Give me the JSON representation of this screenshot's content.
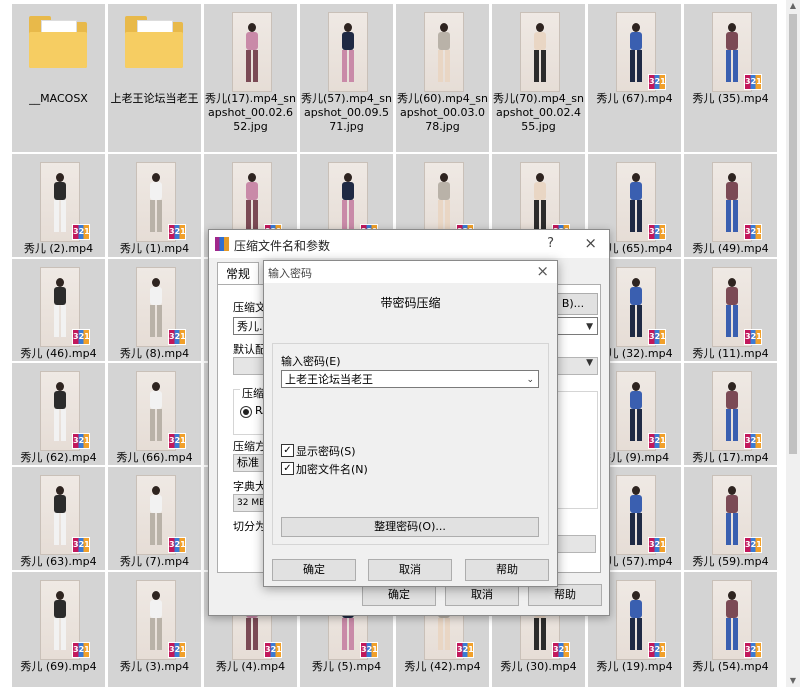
{
  "explorer": {
    "rows": [
      [
        {
          "type": "folder",
          "name": "__MACOSX"
        },
        {
          "type": "folder",
          "name": "上老王论坛当老王"
        },
        {
          "type": "image",
          "name": "秀儿(17).mp4_snapshot_00.02.652.jpg"
        },
        {
          "type": "image",
          "name": "秀儿(57).mp4_snapshot_00.09.571.jpg"
        },
        {
          "type": "image",
          "name": "秀儿(60).mp4_snapshot_00.03.078.jpg"
        },
        {
          "type": "image",
          "name": "秀儿(70).mp4_snapshot_00.02.455.jpg"
        },
        {
          "type": "video",
          "name": "秀儿 (67).mp4"
        },
        {
          "type": "video",
          "name": "秀儿 (35).mp4"
        }
      ],
      [
        {
          "type": "video",
          "name": "秀儿 (2).mp4"
        },
        {
          "type": "video",
          "name": "秀儿 (1).mp4"
        },
        {
          "type": "video",
          "name": ""
        },
        {
          "type": "video",
          "name": ""
        },
        {
          "type": "video",
          "name": ""
        },
        {
          "type": "video",
          "name": ""
        },
        {
          "type": "video",
          "name": "秀儿 (65).mp4"
        },
        {
          "type": "video",
          "name": "秀儿 (49).mp4"
        }
      ],
      [
        {
          "type": "video",
          "name": "秀儿 (46).mp4"
        },
        {
          "type": "video",
          "name": "秀儿 (8).mp4"
        },
        {
          "type": "video",
          "name": ""
        },
        {
          "type": "video",
          "name": ""
        },
        {
          "type": "video",
          "name": ""
        },
        {
          "type": "video",
          "name": ""
        },
        {
          "type": "video",
          "name": "秀儿 (32).mp4"
        },
        {
          "type": "video",
          "name": "秀儿 (11).mp4"
        }
      ],
      [
        {
          "type": "video",
          "name": "秀儿 (62).mp4"
        },
        {
          "type": "video",
          "name": "秀儿 (66).mp4"
        },
        {
          "type": "video",
          "name": ""
        },
        {
          "type": "video",
          "name": ""
        },
        {
          "type": "video",
          "name": ""
        },
        {
          "type": "video",
          "name": ""
        },
        {
          "type": "video",
          "name": "秀儿 (9).mp4"
        },
        {
          "type": "video",
          "name": "秀儿 (17).mp4"
        }
      ],
      [
        {
          "type": "video",
          "name": "秀儿 (63).mp4"
        },
        {
          "type": "video",
          "name": "秀儿 (7).mp4"
        },
        {
          "type": "video",
          "name": ""
        },
        {
          "type": "video",
          "name": ""
        },
        {
          "type": "video",
          "name": ""
        },
        {
          "type": "video",
          "name": ""
        },
        {
          "type": "video",
          "name": "秀儿 (57).mp4"
        },
        {
          "type": "video",
          "name": "秀儿 (59).mp4"
        }
      ],
      [
        {
          "type": "video",
          "name": "秀儿 (69).mp4"
        },
        {
          "type": "video",
          "name": "秀儿 (3).mp4"
        },
        {
          "type": "video",
          "name": "秀儿 (4).mp4"
        },
        {
          "type": "video",
          "name": "秀儿 (5).mp4"
        },
        {
          "type": "video",
          "name": "秀儿 (42).mp4"
        },
        {
          "type": "video",
          "name": "秀儿 (30).mp4"
        },
        {
          "type": "video",
          "name": "秀儿 (19).mp4"
        },
        {
          "type": "video",
          "name": "秀儿 (54).mp4"
        }
      ]
    ],
    "badge_text": "321",
    "outfit_colors": [
      "#2b2b2b",
      "#f2f2f2",
      "#c98aa8",
      "#1f2a44",
      "#b9b2a8",
      "#e9d6c4",
      "#3a5fb0",
      "#7b4a55"
    ]
  },
  "archive_dialog": {
    "title": "压缩文件名和参数",
    "help": "?",
    "close": "×",
    "tab_general": "常规",
    "label_archive_name": "压缩文",
    "archive_name_value": "秀儿.r",
    "browse_label": "B)...",
    "label_default_profile": "默认配",
    "label_format": "压缩",
    "format_option": "RA",
    "label_method": "压缩方",
    "method_value": "标准",
    "label_dict": "字典大",
    "dict_value": "32 MB",
    "label_split": "切分为",
    "ok": "确定",
    "cancel": "取消",
    "help_button": "帮助"
  },
  "password_dialog": {
    "title": "输入密码",
    "close": "×",
    "heading": "带密码压缩",
    "label_enter": "输入密码(E)",
    "password_value": "上老王论坛当老王",
    "show_password_label": "显示密码(S)",
    "show_password_checked": true,
    "encrypt_names_label": "加密文件名(N)",
    "encrypt_names_checked": true,
    "organize_label": "整理密码(O)...",
    "ok": "确定",
    "cancel": "取消",
    "help_button": "帮助"
  }
}
